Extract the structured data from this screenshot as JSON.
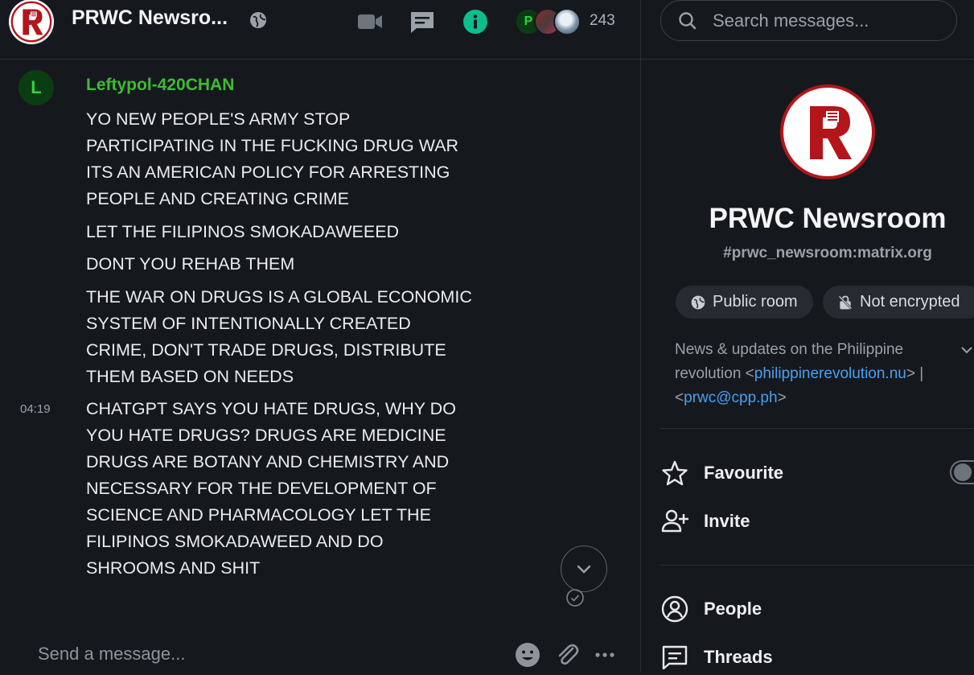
{
  "header": {
    "room_title": "PRWC Newsro...",
    "member_count": "243",
    "facepile_first_initial": "P"
  },
  "timeline": {
    "sender_initial": "L",
    "sender_name": "Leftypol-420CHAN",
    "messages": [
      "YO NEW PEOPLE'S ARMY STOP PARTICIPATING IN THE FUCKING DRUG WAR ITS AN AMERICAN POLICY FOR ARRESTING PEOPLE AND CREATING CRIME",
      "LET THE FILIPINOS SMOKADAWEEED",
      "DONT YOU REHAB THEM",
      "THE WAR ON DRUGS IS A GLOBAL ECONOMIC SYSTEM OF INTENTIONALLY CREATED CRIME, DON'T TRADE DRUGS, DISTRIBUTE THEM BASED ON NEEDS",
      "CHATGPT SAYS YOU HATE DRUGS, WHY DO YOU HATE DRUGS? DRUGS ARE MEDICINE DRUGS ARE BOTANY AND CHEMISTRY AND NECESSARY FOR THE DEVELOPMENT OF SCIENCE AND PHARMACOLOGY LET THE FILIPINOS SMOKADAWEED AND DO SHROOMS AND SHIT"
    ],
    "last_timestamp": "04:19"
  },
  "composer": {
    "placeholder": "Send a message..."
  },
  "right_panel": {
    "search_placeholder": "Search messages...",
    "room_name": "PRWC Newsroom",
    "room_alias": "#prwc_newsroom:matrix.org",
    "chip_public": "Public room",
    "chip_encryption": "Not encrypted",
    "topic_prefix": "News & updates on the Philippine revolution <",
    "topic_link1": "philippinerevolution.nu",
    "topic_middle": "> | <",
    "topic_link2": "prwc@cpp.ph",
    "topic_suffix": ">",
    "favourite_label": "Favourite",
    "favourite_enabled": false,
    "invite_label": "Invite",
    "people_label": "People",
    "threads_label": "Threads"
  },
  "colors": {
    "background": "#15191e",
    "sender_green": "#3fbb33",
    "link_blue": "#4b9ff2",
    "info_icon_green": "#0dbd8b",
    "logo_red": "#b3151b"
  }
}
